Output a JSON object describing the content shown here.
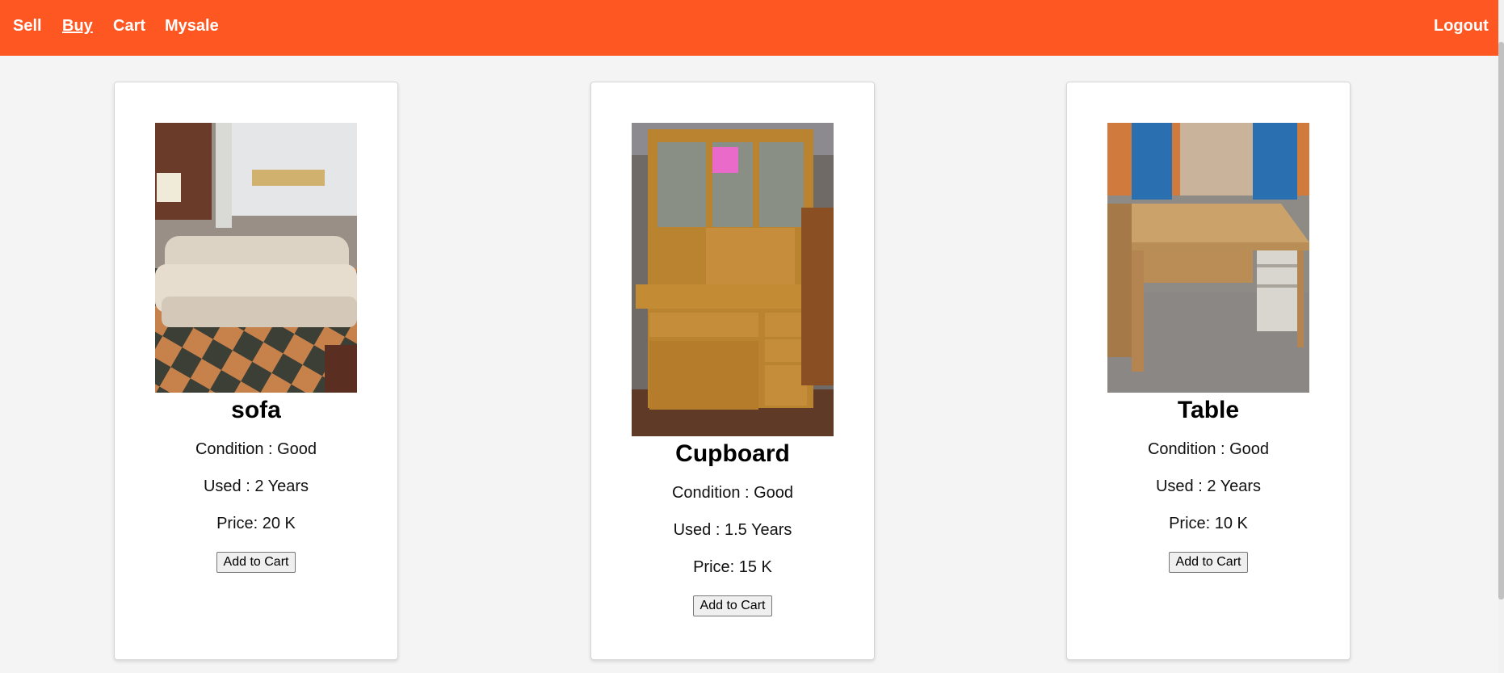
{
  "nav": {
    "sell": "Sell",
    "buy": "Buy",
    "cart": "Cart",
    "mysale": "Mysale",
    "logout": "Logout",
    "accent": "#ff5722"
  },
  "products": [
    {
      "name": "sofa",
      "condition": "Condition : Good",
      "used": "Used : 2 Years",
      "price": "Price: 20 K",
      "button": "Add to Cart"
    },
    {
      "name": "Cupboard",
      "condition": "Condition : Good",
      "used": "Used : 1.5 Years",
      "price": "Price: 15 K",
      "button": "Add to Cart"
    },
    {
      "name": "Table",
      "condition": "Condition : Good",
      "used": "Used : 2 Years",
      "price": "Price: 10 K",
      "button": "Add to Cart"
    }
  ]
}
